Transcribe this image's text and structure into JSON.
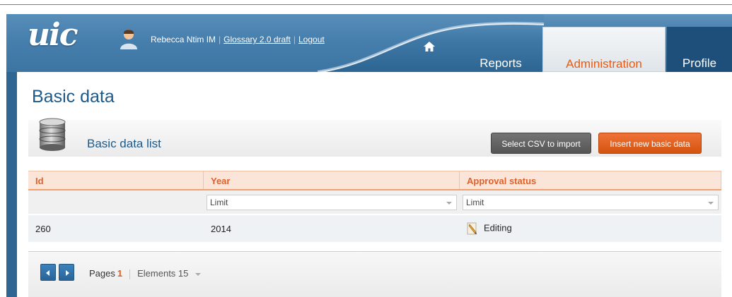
{
  "header": {
    "logo_text": "uic",
    "user_name": "Rebecca Ntim IM",
    "glossary_link": "Glossary 2.0 draft",
    "logout_link": "Logout",
    "tabs": [
      {
        "label": "Reports",
        "active": false
      },
      {
        "label": "Administration",
        "active": true
      },
      {
        "label": "Profile",
        "active": false
      }
    ]
  },
  "page": {
    "title": "Basic data",
    "panel_title": "Basic data list",
    "buttons": {
      "csv": "Select CSV to import",
      "insert": "Insert new basic data"
    }
  },
  "grid": {
    "columns": [
      "Id",
      "Year",
      "Approval status"
    ],
    "filters": {
      "year": "Limit",
      "status": "Limit"
    },
    "rows": [
      {
        "id": "260",
        "year": "2014",
        "status": "Editing"
      }
    ]
  },
  "pager": {
    "pages_label": "Pages",
    "current_page": "1",
    "elements_label": "Elements 15"
  },
  "colors": {
    "accent": "#ea5a12",
    "brand_blue": "#1d5a8a",
    "header_blue": "#2d6592"
  }
}
